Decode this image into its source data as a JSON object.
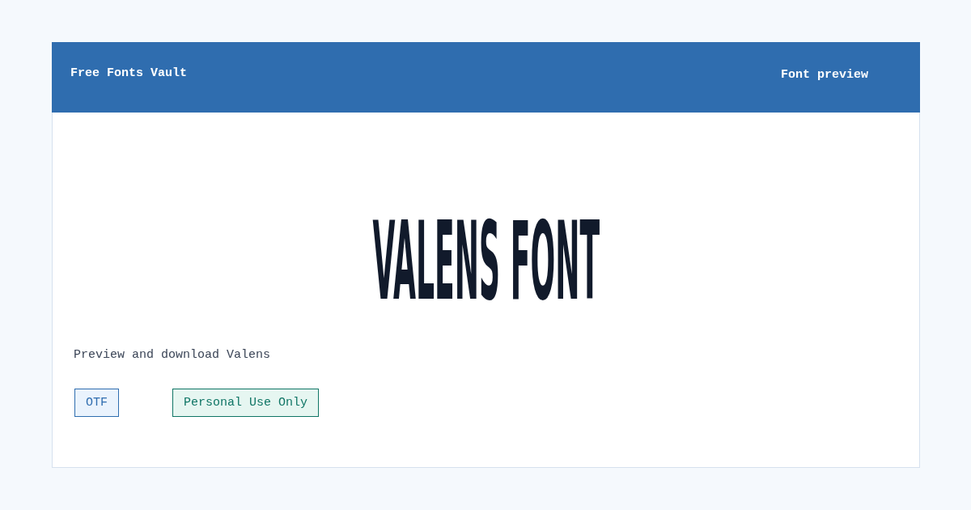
{
  "header": {
    "site_name": "Free Fonts Vault",
    "page_label": "Font preview"
  },
  "preview": {
    "sample_text": "VALENS FONT",
    "caption": "Preview and download Valens"
  },
  "tags": [
    {
      "label": "OTF",
      "kind": "format"
    },
    {
      "label": "Personal Use Only",
      "kind": "license"
    }
  ]
}
